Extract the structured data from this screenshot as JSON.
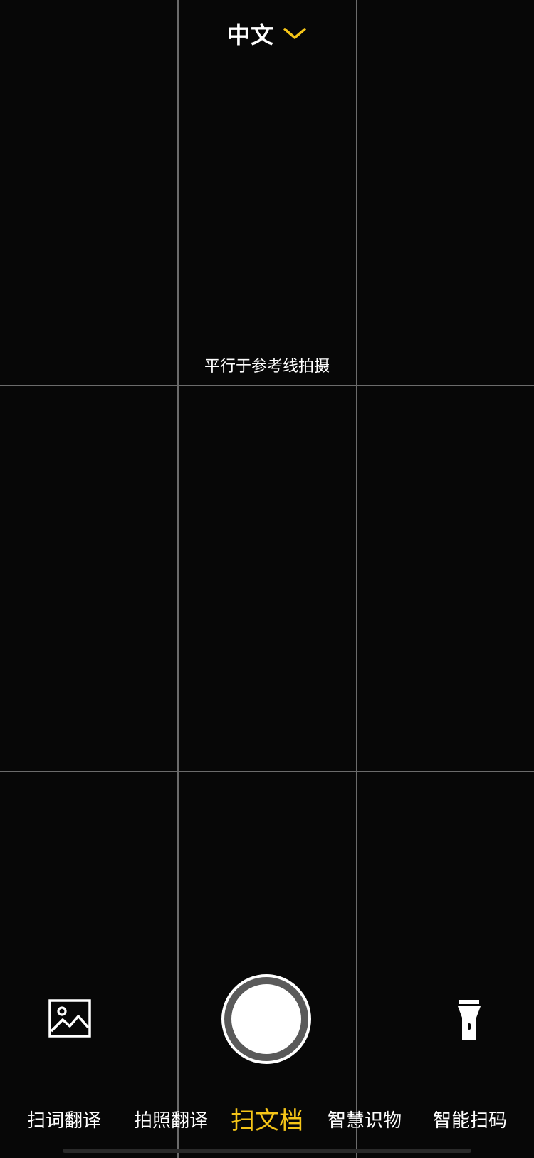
{
  "language_selector": {
    "label": "中文",
    "icon": "chevron-down-icon",
    "accent_color": "#f5c518"
  },
  "viewfinder": {
    "hint": "平行于参考线拍摄",
    "grid": "3x3"
  },
  "controls": {
    "gallery_icon": "image-gallery-icon",
    "shutter_icon": "shutter-button",
    "flashlight_icon": "flashlight-icon"
  },
  "modes": {
    "items": [
      {
        "label": "扫词翻译",
        "active": false
      },
      {
        "label": "拍照翻译",
        "active": false
      },
      {
        "label": "扫文档",
        "active": true
      },
      {
        "label": "智慧识物",
        "active": false
      },
      {
        "label": "智能扫码",
        "active": false
      }
    ],
    "active_color": "#f5c518",
    "inactive_color": "#ffffff"
  }
}
